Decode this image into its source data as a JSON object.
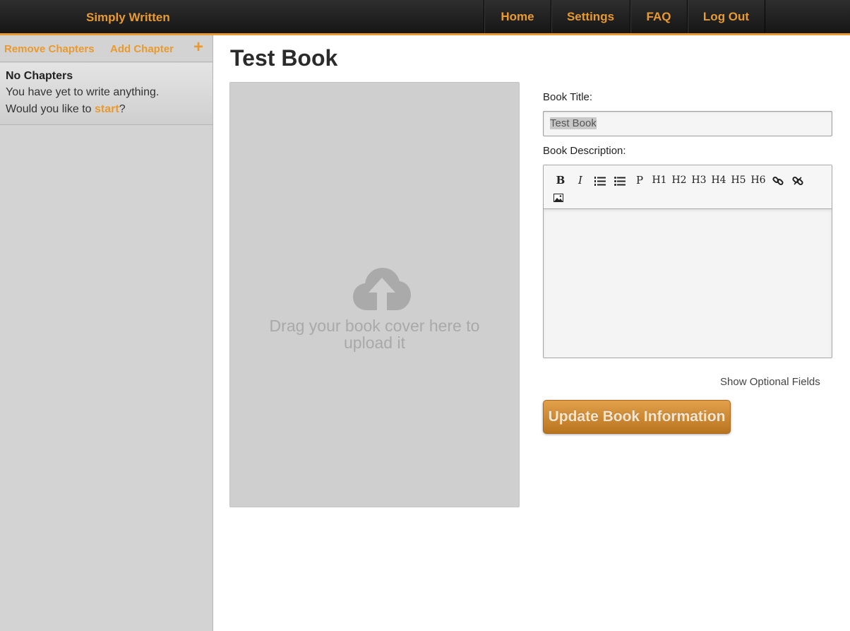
{
  "app": {
    "brand": "Simply Written"
  },
  "nav": {
    "home": "Home",
    "settings": "Settings",
    "faq": "FAQ",
    "logout": "Log Out"
  },
  "sidebar": {
    "remove_chapters": "Remove Chapters",
    "add_chapter": "Add Chapter",
    "add_icon_glyph": "+",
    "empty": {
      "title": "No Chapters",
      "line1": "You have yet to write anything.",
      "line2_prefix": "Would you like to ",
      "line2_link": "start",
      "line2_suffix": "?"
    }
  },
  "main": {
    "title": "Test Book",
    "dropzone_text": "Drag your book cover here to upload it",
    "form": {
      "title_label": "Book Title:",
      "title_value": "Test Book",
      "description_label": "Book Description:",
      "toolbar": {
        "bold": "B",
        "italic": "I",
        "paragraph": "P",
        "h1": "H1",
        "h2": "H2",
        "h3": "H3",
        "h4": "H4",
        "h5": "H5",
        "h6": "H6"
      },
      "optional_fields": "Show Optional Fields",
      "submit": "Update Book Information"
    }
  },
  "icons": [
    "plus-icon",
    "cloud-upload-icon",
    "ordered-list-icon",
    "unordered-list-icon",
    "link-icon",
    "unlink-icon",
    "image-icon"
  ],
  "colors": {
    "accent": "#e99a2f",
    "topbar": "#1f1f1f",
    "sidebar": "#d3d3d3",
    "dropzone": "#cfcfcf"
  }
}
